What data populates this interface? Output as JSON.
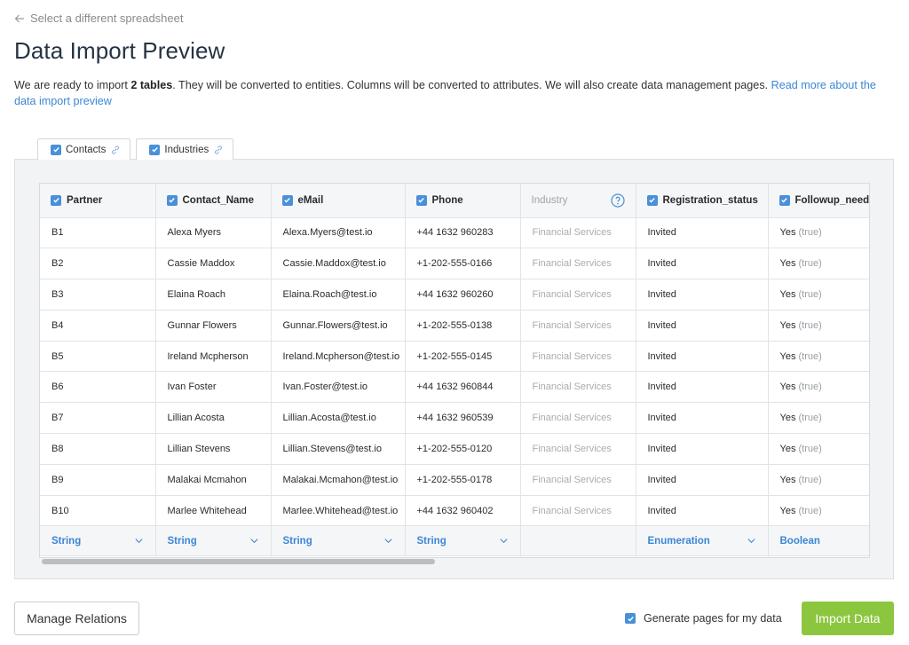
{
  "back_link": "Select a different spreadsheet",
  "title": "Data Import Preview",
  "intro": {
    "before": "We are ready to import ",
    "bold": "2 tables",
    "after": ". They will be converted to entities. Columns will be converted to attributes. We will also create data management pages. ",
    "link": "Read more about the data import preview"
  },
  "tabs": [
    {
      "label": "Contacts",
      "checked": true
    },
    {
      "label": "Industries",
      "checked": true
    }
  ],
  "columns": [
    {
      "label": "Partner",
      "checked": true,
      "type": "String"
    },
    {
      "label": "Contact_Name",
      "checked": true,
      "type": "String"
    },
    {
      "label": "eMail",
      "checked": true,
      "type": "String"
    },
    {
      "label": "Phone",
      "checked": true,
      "type": "String"
    },
    {
      "label": "Industry",
      "checked": false,
      "type": ""
    },
    {
      "label": "Registration_status",
      "checked": true,
      "type": "Enumeration"
    },
    {
      "label": "Followup_needed",
      "checked": true,
      "type": "Boolean"
    }
  ],
  "rows": [
    [
      "B1",
      "Alexa Myers",
      "Alexa.Myers@test.io",
      "+44 1632 960283",
      "Financial Services",
      "Invited",
      "Yes",
      "(true)"
    ],
    [
      "B2",
      "Cassie Maddox",
      "Cassie.Maddox@test.io",
      "+1-202-555-0166",
      "Financial Services",
      "Invited",
      "Yes",
      "(true)"
    ],
    [
      "B3",
      "Elaina Roach",
      "Elaina.Roach@test.io",
      "+44 1632 960260",
      "Financial Services",
      "Invited",
      "Yes",
      "(true)"
    ],
    [
      "B4",
      "Gunnar Flowers",
      "Gunnar.Flowers@test.io",
      "+1-202-555-0138",
      "Financial Services",
      "Invited",
      "Yes",
      "(true)"
    ],
    [
      "B5",
      "Ireland Mcpherson",
      "Ireland.Mcpherson@test.io",
      "+1-202-555-0145",
      "Financial Services",
      "Invited",
      "Yes",
      "(true)"
    ],
    [
      "B6",
      "Ivan Foster",
      "Ivan.Foster@test.io",
      "+44 1632 960844",
      "Financial Services",
      "Invited",
      "Yes",
      "(true)"
    ],
    [
      "B7",
      "Lillian Acosta",
      "Lillian.Acosta@test.io",
      "+44 1632 960539",
      "Financial Services",
      "Invited",
      "Yes",
      "(true)"
    ],
    [
      "B8",
      "Lillian Stevens",
      "Lillian.Stevens@test.io",
      "+1-202-555-0120",
      "Financial Services",
      "Invited",
      "Yes",
      "(true)"
    ],
    [
      "B9",
      "Malakai Mcmahon",
      "Malakai.Mcmahon@test.io",
      "+1-202-555-0178",
      "Financial Services",
      "Invited",
      "Yes",
      "(true)"
    ],
    [
      "B10",
      "Marlee Whitehead",
      "Marlee.Whitehead@test.io",
      "+44 1632 960402",
      "Financial Services",
      "Invited",
      "Yes",
      "(true)"
    ]
  ],
  "footer": {
    "manage_relations": "Manage Relations",
    "generate_pages": "Generate pages for my data",
    "generate_checked": true,
    "import": "Import Data"
  },
  "colors": {
    "accent": "#3b86d6",
    "checkbox": "#4a90d9",
    "import_button": "#8cc63f"
  }
}
